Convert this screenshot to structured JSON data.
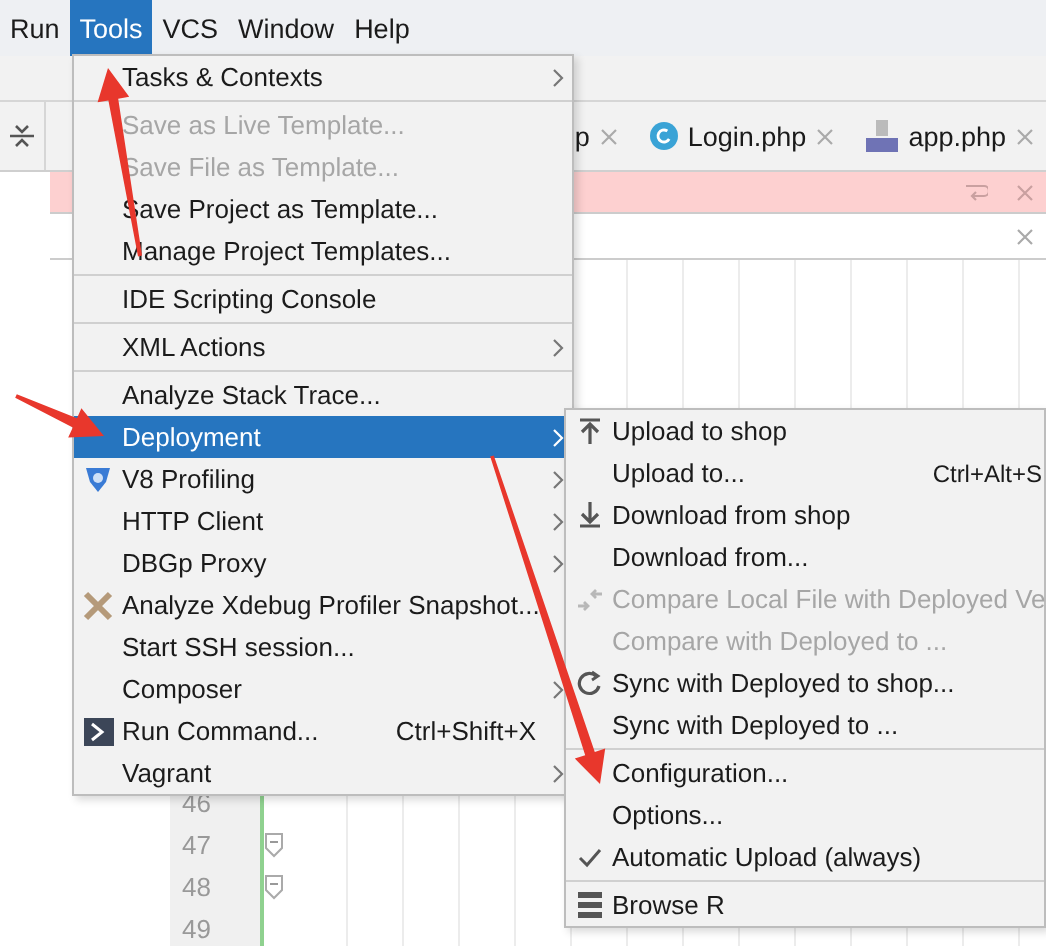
{
  "menu_bar": [
    {
      "label": "Run",
      "selected": false
    },
    {
      "label": "Tools",
      "selected": true
    },
    {
      "label": "VCS",
      "selected": false
    },
    {
      "label": "Window",
      "selected": false
    },
    {
      "label": "Help",
      "selected": false
    }
  ],
  "editor_tabs": [
    {
      "label": "p",
      "kind": "plain"
    },
    {
      "label": "Login.php",
      "kind": "class"
    },
    {
      "label": "app.php",
      "kind": "php"
    }
  ],
  "line_numbers": [
    {
      "label": "46",
      "fold": false
    },
    {
      "label": "47",
      "fold": true
    },
    {
      "label": "48",
      "fold": true
    },
    {
      "label": "49",
      "fold": false
    }
  ],
  "tools_menu": {
    "items": [
      {
        "kind": "item",
        "label": "Tasks & Contexts",
        "submenu": true,
        "disabled": false,
        "selected": false
      },
      {
        "kind": "separator"
      },
      {
        "kind": "item",
        "label": "Save as Live Template...",
        "submenu": false,
        "disabled": true,
        "selected": false
      },
      {
        "kind": "item",
        "label": "Save File as Template...",
        "submenu": false,
        "disabled": true,
        "selected": false
      },
      {
        "kind": "item",
        "label": "Save Project as Template...",
        "submenu": false,
        "disabled": false,
        "selected": false
      },
      {
        "kind": "item",
        "label": "Manage Project Templates...",
        "submenu": false,
        "disabled": false,
        "selected": false
      },
      {
        "kind": "separator"
      },
      {
        "kind": "item",
        "label": "IDE Scripting Console",
        "submenu": false,
        "disabled": false,
        "selected": false
      },
      {
        "kind": "separator"
      },
      {
        "kind": "item",
        "label": "XML Actions",
        "submenu": true,
        "disabled": false,
        "selected": false
      },
      {
        "kind": "separator"
      },
      {
        "kind": "item",
        "label": "Analyze Stack Trace...",
        "submenu": false,
        "disabled": false,
        "selected": false
      },
      {
        "kind": "item",
        "label": "Deployment",
        "submenu": true,
        "disabled": false,
        "selected": true
      },
      {
        "kind": "v8",
        "label": "V8 Profiling",
        "submenu": true,
        "disabled": false,
        "selected": false
      },
      {
        "kind": "item",
        "label": "HTTP Client",
        "submenu": true,
        "disabled": false,
        "selected": false
      },
      {
        "kind": "item",
        "label": "DBGp Proxy",
        "submenu": true,
        "disabled": false,
        "selected": false
      },
      {
        "kind": "xdebug",
        "label": "Analyze Xdebug Profiler Snapshot...",
        "submenu": false,
        "disabled": false,
        "selected": false
      },
      {
        "kind": "item",
        "label": "Start SSH session...",
        "submenu": false,
        "disabled": false,
        "selected": false
      },
      {
        "kind": "item",
        "label": "Composer",
        "submenu": true,
        "disabled": false,
        "selected": false
      },
      {
        "kind": "terminal",
        "label": "Run Command...",
        "shortcut": "Ctrl+Shift+X",
        "submenu": false,
        "disabled": false,
        "selected": false
      },
      {
        "kind": "item",
        "label": "Vagrant",
        "submenu": true,
        "disabled": false,
        "selected": false
      }
    ]
  },
  "deployment_submenu": {
    "items": [
      {
        "kind": "upload",
        "label": "Upload to shop",
        "disabled": false,
        "checked": false
      },
      {
        "kind": "item",
        "label": "Upload to...",
        "shortcut": "Ctrl+Alt+S",
        "disabled": false,
        "checked": false
      },
      {
        "kind": "download",
        "label": "Download from shop",
        "disabled": false,
        "checked": false
      },
      {
        "kind": "item",
        "label": "Download from...",
        "disabled": false,
        "checked": false
      },
      {
        "kind": "compare",
        "label": "Compare Local File with Deployed Ve",
        "disabled": true,
        "checked": false
      },
      {
        "kind": "item",
        "label": "Compare with Deployed to ...",
        "disabled": true,
        "checked": false
      },
      {
        "kind": "sync",
        "label": "Sync with Deployed to shop...",
        "disabled": false,
        "checked": false
      },
      {
        "kind": "item",
        "label": "Sync with Deployed to ...",
        "disabled": false,
        "checked": false
      },
      {
        "kind": "separator"
      },
      {
        "kind": "item",
        "label": "Configuration...",
        "disabled": false,
        "checked": false
      },
      {
        "kind": "item",
        "label": "Options...",
        "disabled": false,
        "checked": false
      },
      {
        "kind": "item",
        "label": "Automatic Upload (always)",
        "disabled": false,
        "checked": true
      },
      {
        "kind": "separator"
      },
      {
        "kind": "browse",
        "label": "Browse R",
        "disabled": false,
        "checked": false
      }
    ]
  },
  "annotations": [
    {
      "kind": "arrow"
    },
    {
      "kind": "arrow"
    },
    {
      "kind": "arrow"
    }
  ]
}
